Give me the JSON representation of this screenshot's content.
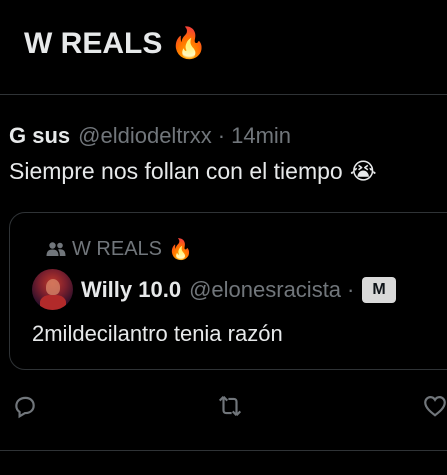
{
  "header": {
    "title": "W REALS",
    "emoji": "🔥"
  },
  "post": {
    "author_name": "G sus",
    "handle": "@eldiodeltrxx",
    "separator": "·",
    "time": "14min",
    "text": "Siempre nos follan con el tiempo",
    "text_emoji": "😭",
    "quote": {
      "community_icon": "community-icon",
      "community_name": "W REALS",
      "community_emoji": "🔥",
      "author_name": "Willy 10.0",
      "handle": "@elonesracista",
      "separator": "·",
      "badge": "M",
      "text": "2mildecilantro tenia razón"
    },
    "actions": [
      {
        "icon": "reply-icon"
      },
      {
        "icon": "repost-icon"
      },
      {
        "icon": "like-icon"
      }
    ]
  },
  "colors": {
    "background": "#000000",
    "text": "#e7e9ea",
    "muted": "#71767b",
    "border": "#2f3336",
    "badge_bg": "#d9d9d9"
  }
}
